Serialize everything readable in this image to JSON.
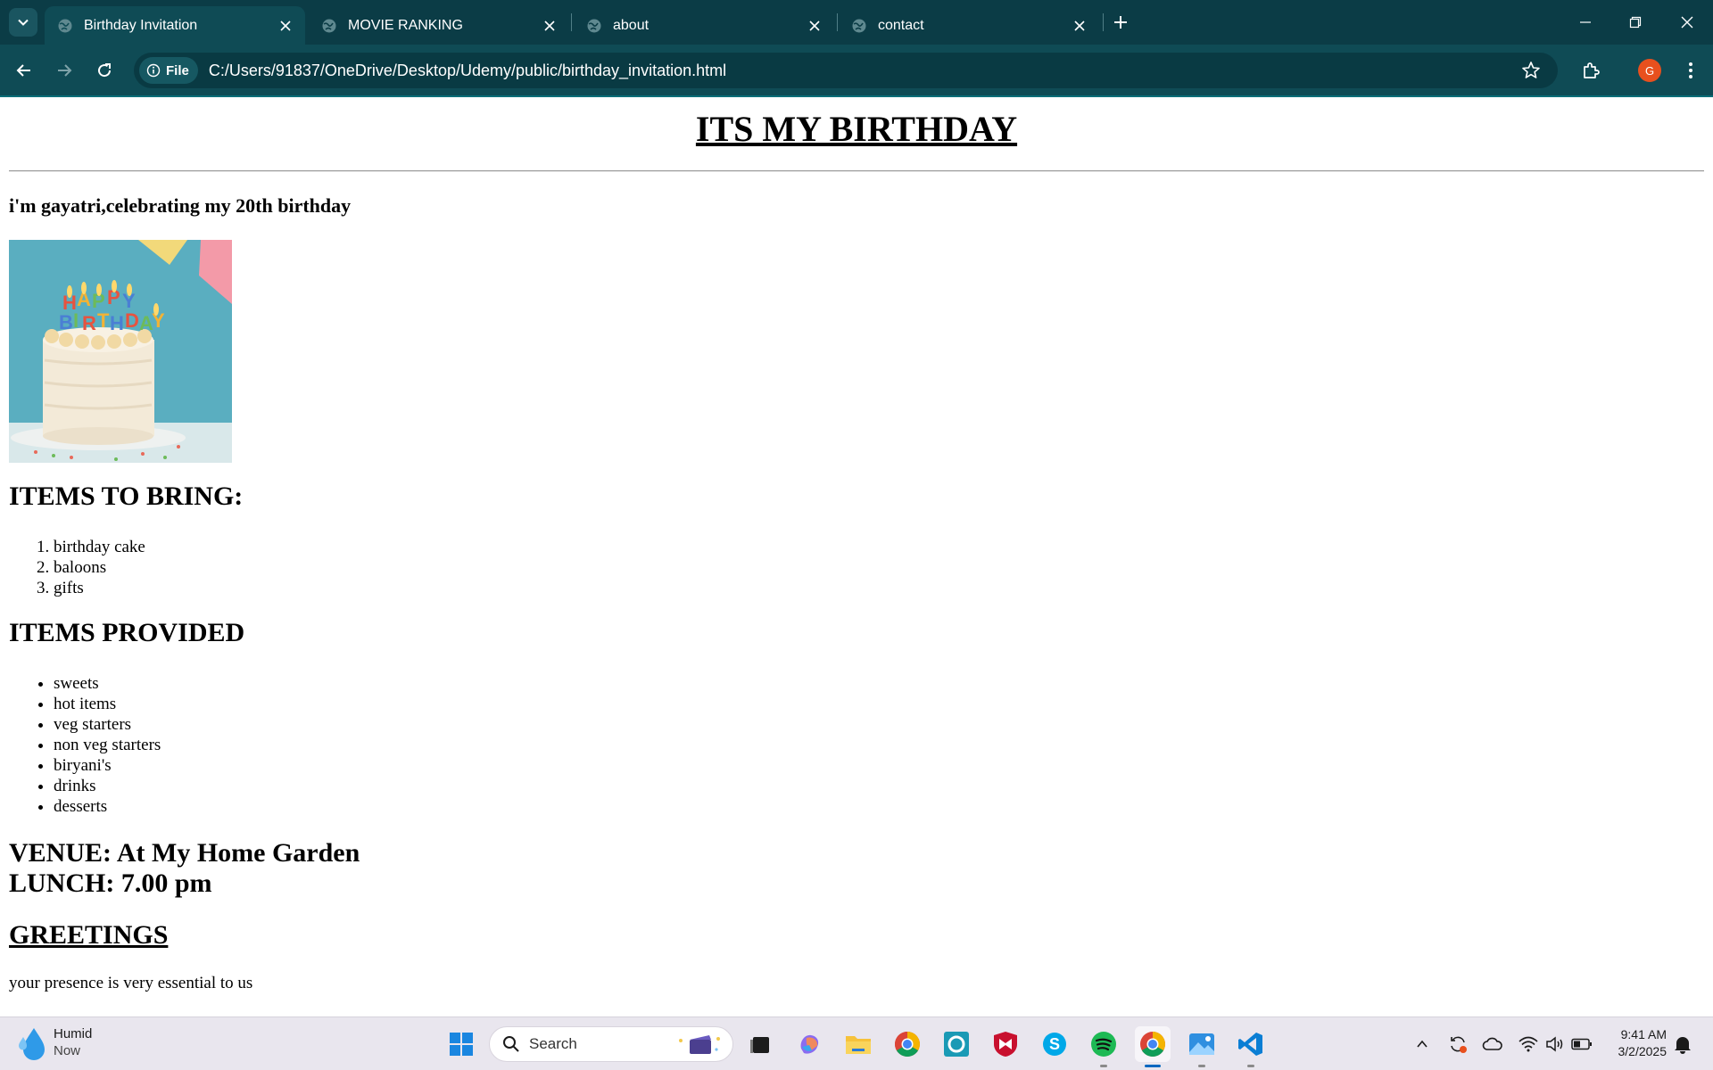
{
  "browser": {
    "tabs": [
      {
        "title": "Birthday Invitation",
        "active": true
      },
      {
        "title": "MOVIE RANKING",
        "active": false
      },
      {
        "title": "about",
        "active": false
      },
      {
        "title": "contact",
        "active": false
      }
    ],
    "address": {
      "chip_label": "File",
      "url": "C:/Users/91837/OneDrive/Desktop/Udemy/public/birthday_invitation.html"
    },
    "profile_initial": "G",
    "colors": {
      "tabstrip": "#0b3c46",
      "toolbar": "#0f4b55",
      "avatar": "#e8501e"
    }
  },
  "page": {
    "title": "ITS MY BIRTHDAY",
    "intro": "i'm gayatri,celebrating my 20th birthday",
    "cake_image": "birthday cake with candles",
    "bring_heading": "ITEMS TO BRING:",
    "bring_items": [
      "birthday cake",
      "baloons",
      "gifts"
    ],
    "provided_heading": "ITEMS PROVIDED",
    "provided_items": [
      "sweets",
      "hot items",
      "veg starters",
      "non veg starters",
      "biryani's",
      "drinks",
      "desserts"
    ],
    "venue": "VENUE: At My Home Garden",
    "lunch": "LUNCH: 7.00 pm",
    "greetings_heading": "GREETINGS",
    "greetings_text": "your presence is very essential to us"
  },
  "taskbar": {
    "weather": {
      "condition": "Humid",
      "time": "Now"
    },
    "search_placeholder": "Search",
    "apps": [
      "start-icon",
      "search-icon",
      "task-view-icon",
      "copilot-icon",
      "file-explorer-icon",
      "chrome-icon",
      "alexa-icon",
      "mcafee-icon",
      "skype-icon",
      "spotify-icon",
      "chrome-active-icon",
      "photos-icon",
      "vscode-icon"
    ],
    "clock": {
      "time": "9:41 AM",
      "date": "3/2/2025"
    }
  }
}
